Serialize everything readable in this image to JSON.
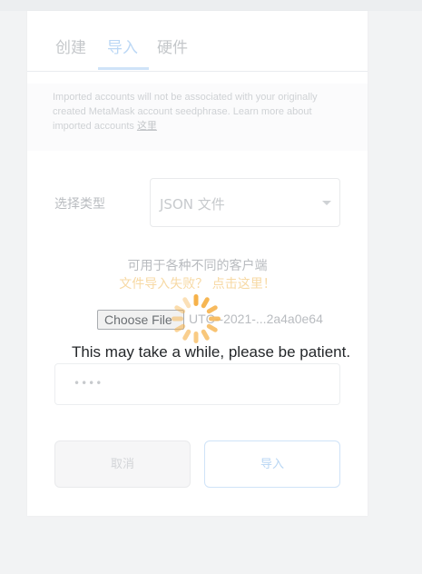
{
  "tabs": [
    {
      "label": "创建"
    },
    {
      "label": "导入",
      "active": true
    },
    {
      "label": "硬件"
    }
  ],
  "notice": {
    "text": "Imported accounts will not be associated with your originally created MetaMask account seedphrase. Learn more about imported accounts ",
    "link_label": "这里"
  },
  "import_form": {
    "type_label": "选择类型",
    "type_value": "JSON 文件",
    "help_text": "可用于各种不同的客户端",
    "help_link": "文件导入失败？ 点击这里！",
    "file_button_label": "Choose File",
    "file_name": "UTC--2021-...2a4a0e64",
    "password_value": "••••"
  },
  "buttons": {
    "cancel": "取消",
    "import": "导入"
  },
  "loading": {
    "message": "This may take a while, please be patient."
  },
  "colors": {
    "spinner": "#f6b24a",
    "active_tab": "#bcd8f5",
    "link": "#f7d9a4"
  }
}
